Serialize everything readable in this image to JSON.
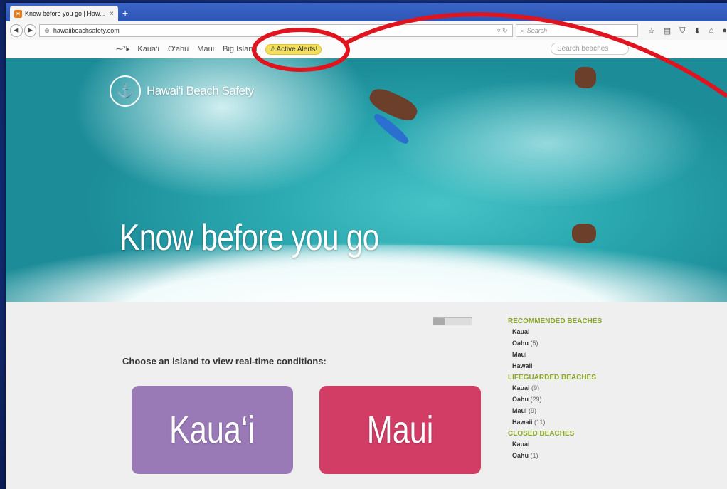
{
  "browser": {
    "tab_title": "Know before you go | Haw...",
    "tab_close": "×",
    "new_tab": "+",
    "url": "hawaiibeachsafety.com",
    "search_placeholder": "Search"
  },
  "site_nav": {
    "items": [
      "Kaua‘i",
      "O‘ahu",
      "Maui",
      "Big Island"
    ],
    "alert_label": "⚠Active Alerts!",
    "search_placeholder": "Search beaches"
  },
  "hero": {
    "logo_text": "Hawai‘i Beach Safety",
    "title": "Know before you go"
  },
  "main": {
    "choose_text": "Choose an island to view real-time conditions:",
    "islands": [
      "Kaua‘i",
      "Maui"
    ]
  },
  "sidebar": {
    "recommended_heading": "RECOMMENDED BEACHES",
    "recommended": [
      {
        "name": "Kauai",
        "count": ""
      },
      {
        "name": "Oahu",
        "count": "(5)"
      },
      {
        "name": "Maui",
        "count": ""
      },
      {
        "name": "Hawaii",
        "count": ""
      }
    ],
    "lifeguarded_heading": "LIFEGUARDED BEACHES",
    "lifeguarded": [
      {
        "name": "Kauai",
        "count": "(9)"
      },
      {
        "name": "Oahu",
        "count": "(29)"
      },
      {
        "name": "Maui",
        "count": "(9)"
      },
      {
        "name": "Hawaii",
        "count": "(11)"
      }
    ],
    "closed_heading": "CLOSED BEACHES",
    "closed": [
      {
        "name": "Kauai",
        "count": ""
      },
      {
        "name": "Oahu",
        "count": "(1)"
      }
    ]
  },
  "colors": {
    "slide_background": "#1f3f9e",
    "annotation": "#e0141e",
    "alert": "#f5e05a",
    "kauai": "#9a79b7",
    "maui": "#d23d66",
    "sidebar_heading": "#89a72a"
  }
}
